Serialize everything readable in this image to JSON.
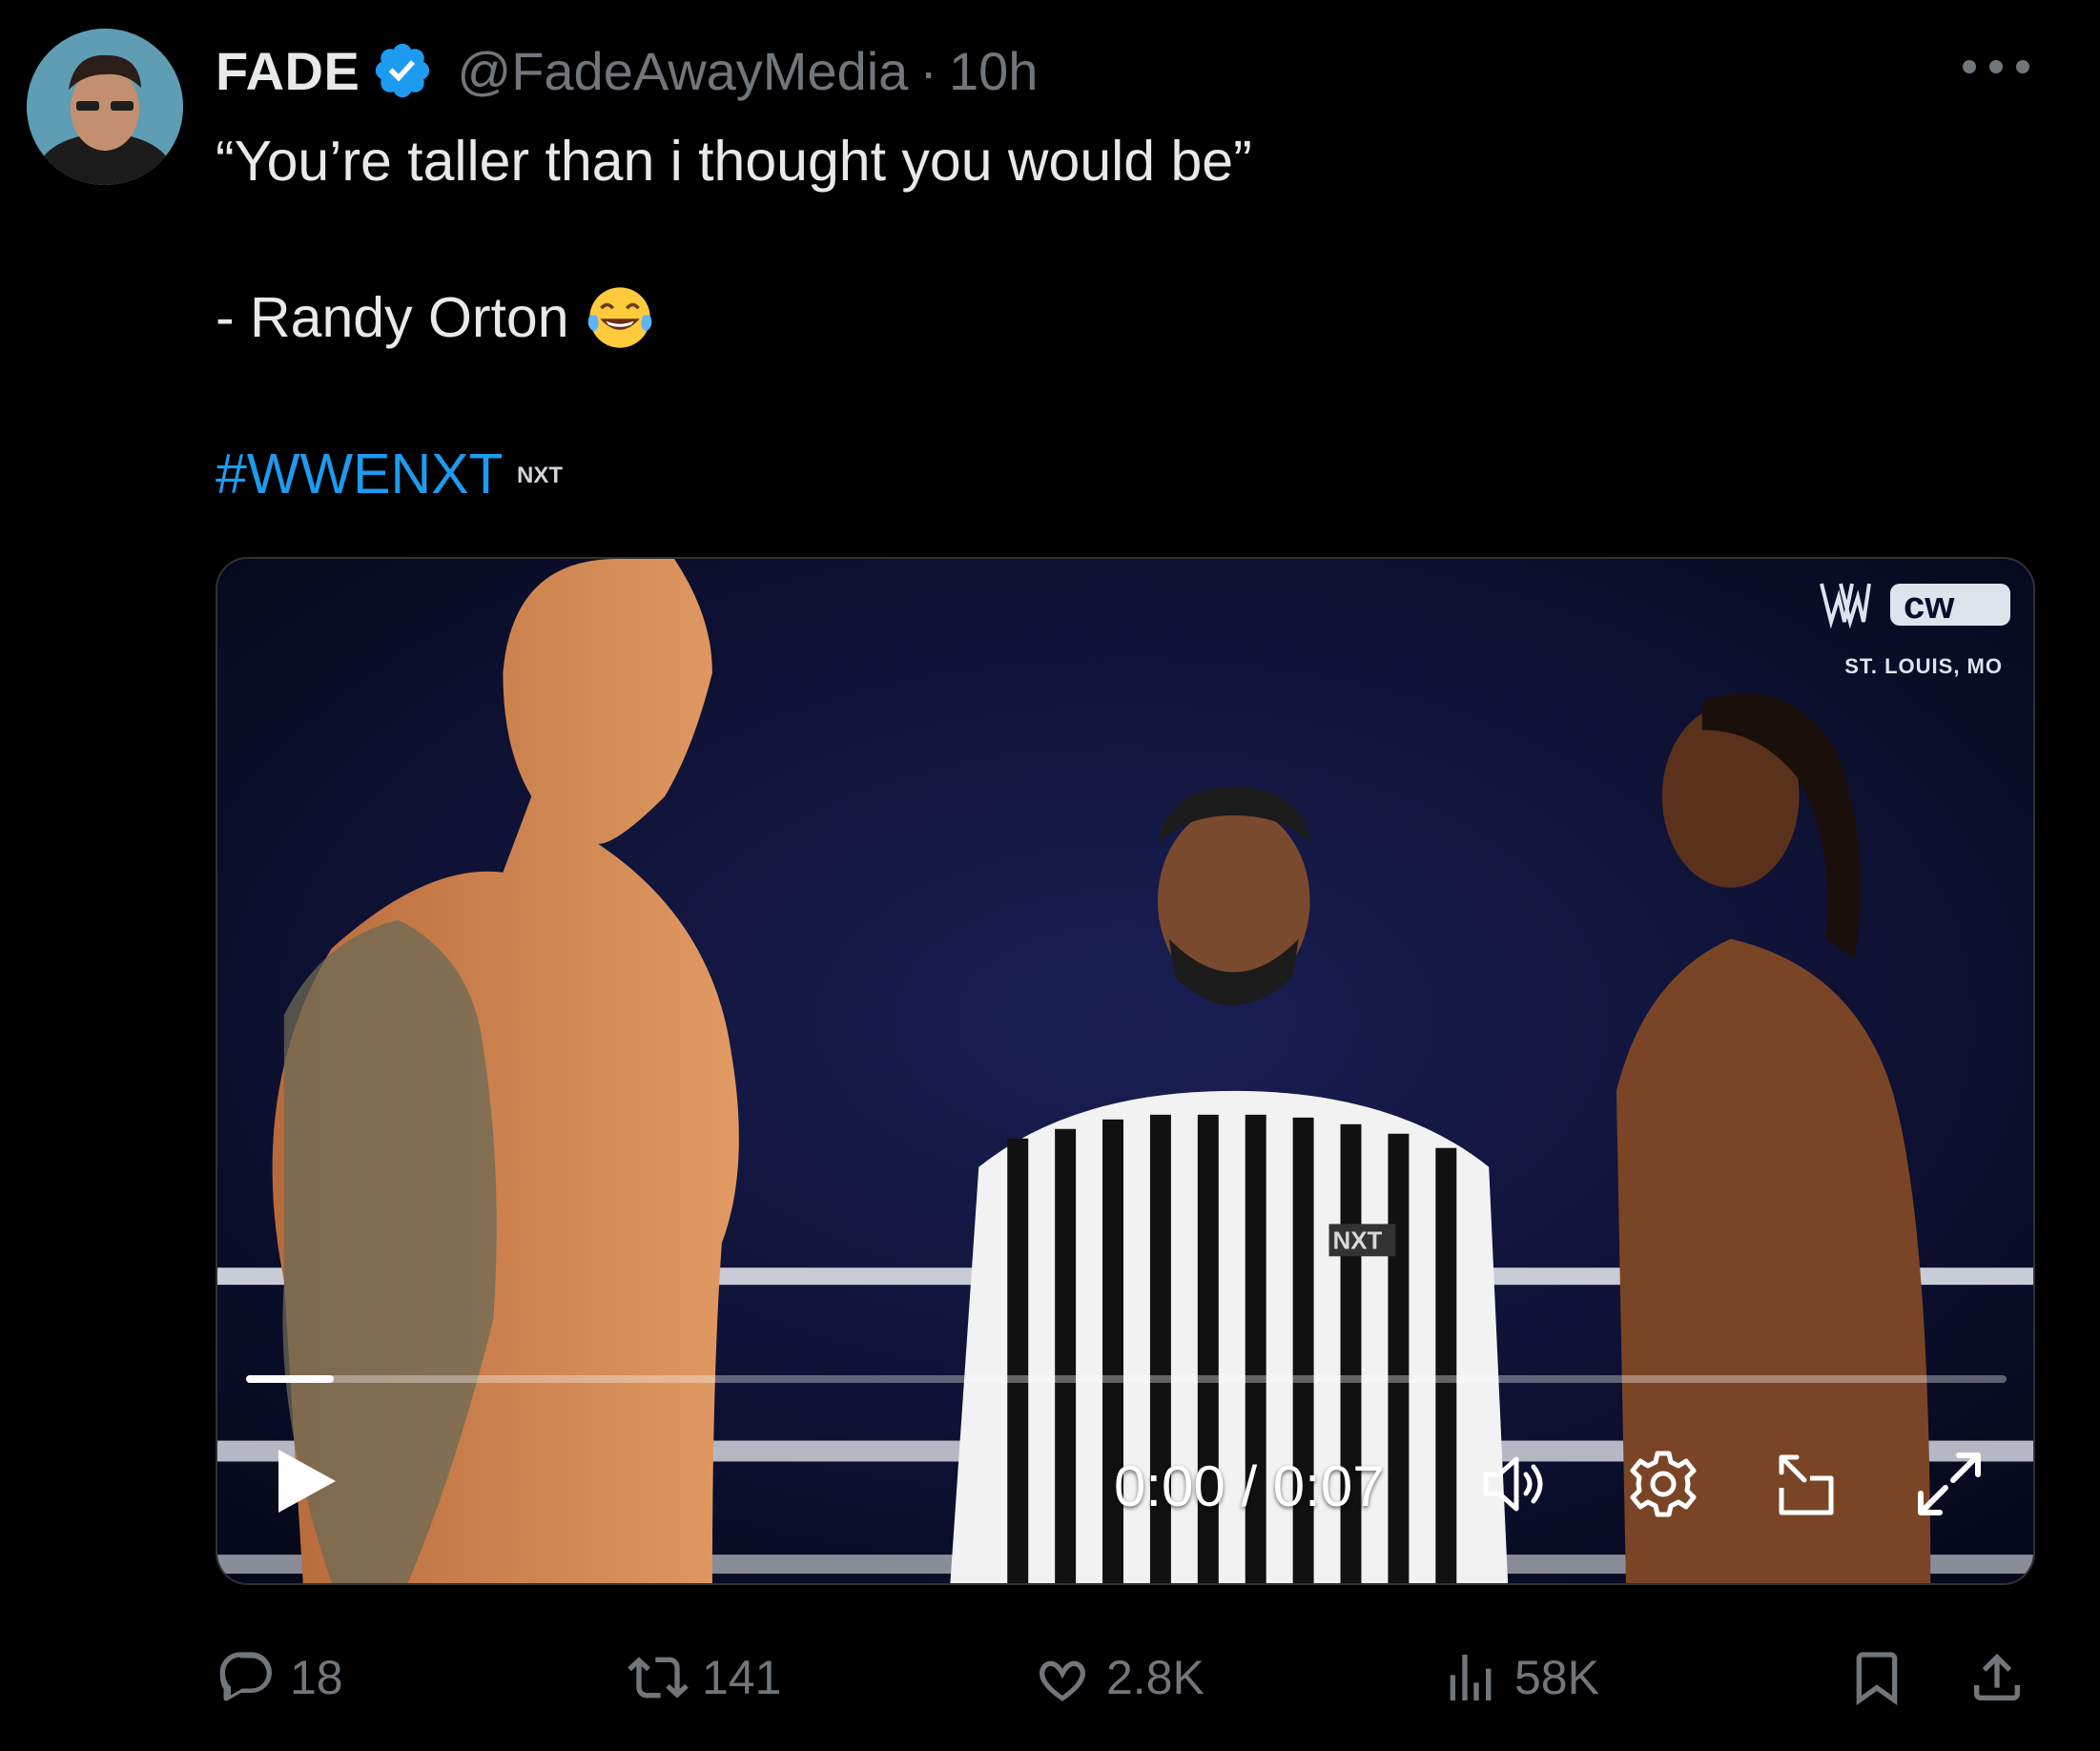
{
  "author": {
    "display_name": "FADE",
    "handle": "@FadeAwayMedia",
    "separator": "·",
    "time": "10h",
    "verified": true,
    "avatar_icon": "avatar-photo"
  },
  "tweet": {
    "line1": "“You’re taller than i thought you would be”",
    "line2": "- Randy Orton",
    "line2_emoji": "face-with-tears-of-joy-icon",
    "hashtag": "#WWENXT",
    "hashtag_badge": "NXT"
  },
  "media": {
    "brand_logos": [
      "WWE",
      "cw"
    ],
    "location": "ST. LOUIS, MO",
    "jersey_logo": "NXT",
    "time_readout": "0:00 / 0:07",
    "progress": 0.05,
    "accent_color": "#1d9bf0"
  },
  "actions": {
    "replies": "18",
    "reposts": "141",
    "likes": "2.8K",
    "views": "58K"
  }
}
